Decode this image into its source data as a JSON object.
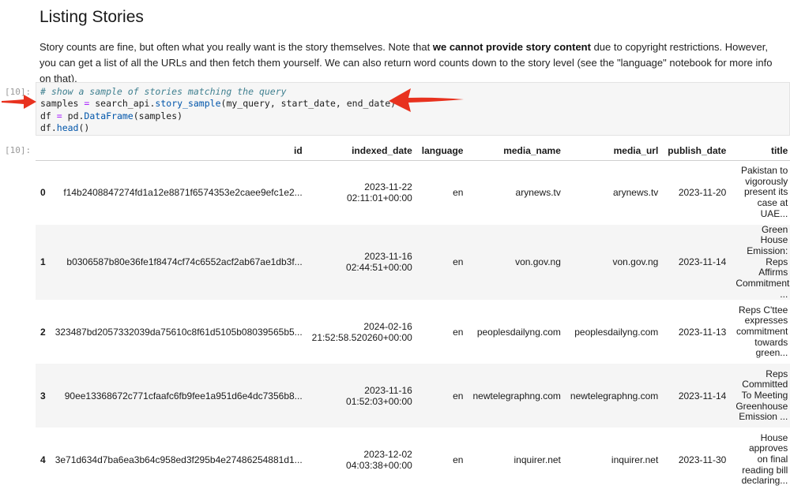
{
  "heading": "Listing Stories",
  "paragraph": {
    "part1": "Story counts are fine, but often what you really want is the story themselves. Note that ",
    "bold": "we cannot provide story content",
    "part2": " due to copyright restrictions. However, you can get a list of all the URLs and then fetch them yourself. We can also return word counts down to the story level (see the \"language\" notebook for more info on that)."
  },
  "code_cell": {
    "prompt": "[10]:",
    "lines": {
      "comment": "# show a sample of stories matching the query",
      "l2_var": "samples",
      "l2_eq": " = ",
      "l2_obj": "search_api.",
      "l2_method": "story_sample",
      "l2_args": "(my_query, start_date, end_date)",
      "l3_var": "df",
      "l3_eq": " = ",
      "l3_obj": "pd.",
      "l3_method": "DataFrame",
      "l3_args": "(samples)",
      "l4_obj": "df.",
      "l4_method": "head",
      "l4_args": "()"
    }
  },
  "output_cell": {
    "prompt": "[10]:",
    "columns": [
      "",
      "id",
      "indexed_date",
      "language",
      "media_name",
      "media_url",
      "publish_date",
      "title"
    ],
    "rows": [
      {
        "index": "0",
        "id": "f14b2408847274fd1a12e8871f6574353e2caee9efc1e2...",
        "indexed_date": [
          "2023-11-22",
          "02:11:01+00:00"
        ],
        "language": "en",
        "media_name": "arynews.tv",
        "media_url": "arynews.tv",
        "publish_date": "2023-11-20",
        "title": "Pakistan to vigorously present its case at UAE..."
      },
      {
        "index": "1",
        "id": "b0306587b80e36fe1f8474cf74c6552acf2ab67ae1db3f...",
        "indexed_date": [
          "2023-11-16",
          "02:44:51+00:00"
        ],
        "language": "en",
        "media_name": "von.gov.ng",
        "media_url": "von.gov.ng",
        "publish_date": "2023-11-14",
        "title": "Green House Emission: Reps Affirms Commitment ..."
      },
      {
        "index": "2",
        "id": "323487bd2057332039da75610c8f61d5105b08039565b5...",
        "indexed_date": [
          "2024-02-16",
          "21:52:58.520260+00:00"
        ],
        "language": "en",
        "media_name": "peoplesdailyng.com",
        "media_url": "peoplesdailyng.com",
        "publish_date": "2023-11-13",
        "title": "Reps C'ttee expresses commitment towards green..."
      },
      {
        "index": "3",
        "id": "90ee13368672c771cfaafc6fb9fee1a951d6e4dc7356b8...",
        "indexed_date": [
          "2023-11-16",
          "01:52:03+00:00"
        ],
        "language": "en",
        "media_name": "newtelegraphng.com",
        "media_url": "newtelegraphng.com",
        "publish_date": "2023-11-14",
        "title": "Reps Committed To Meeting Greenhouse Emission ..."
      },
      {
        "index": "4",
        "id": "3e71d634d7ba6ea3b64c958ed3f295b4e27486254881d1...",
        "indexed_date": [
          "2023-12-02",
          "04:03:38+00:00"
        ],
        "language": "en",
        "media_name": "inquirer.net",
        "media_url": "inquirer.net",
        "publish_date": "2023-11-30",
        "title": "House approves on final reading bill declaring..."
      }
    ]
  },
  "colors": {
    "arrow": "#e8321f",
    "code_bg": "#f6f6f6",
    "prompt": "#9a9a9a",
    "row_stripe": "#f5f5f5"
  },
  "icons": [
    "red-arrow-annotation"
  ]
}
